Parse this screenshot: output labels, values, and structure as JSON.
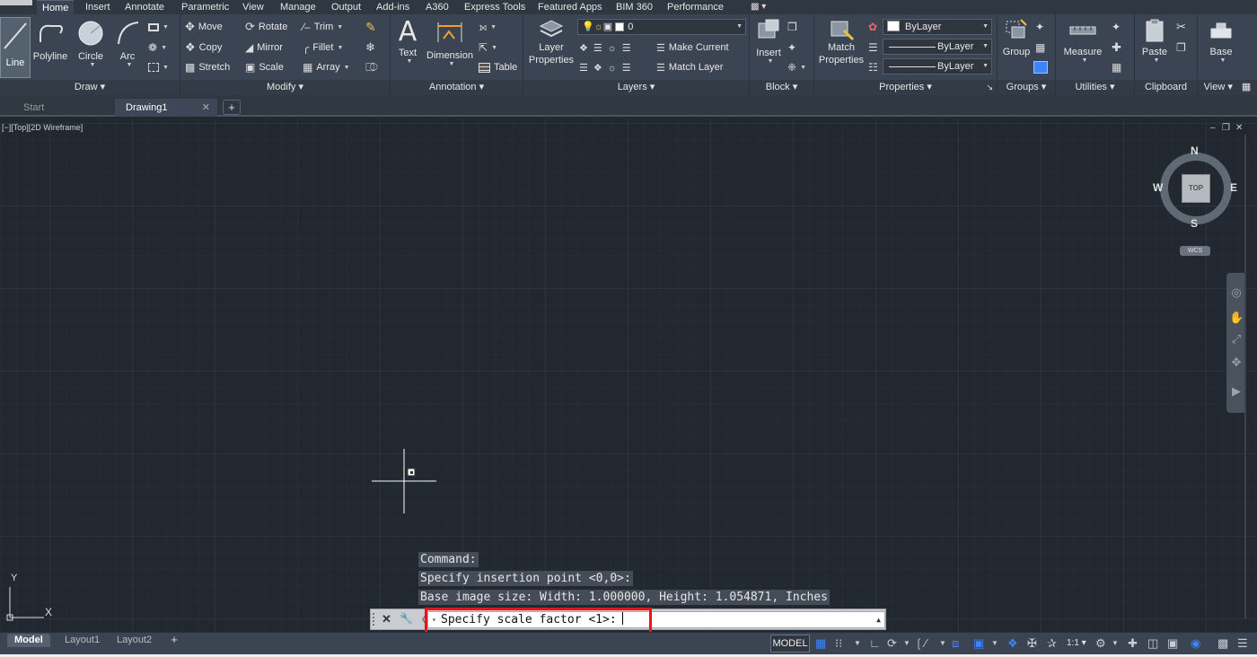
{
  "ribbon_tabs": [
    "Home",
    "Insert",
    "Annotate",
    "Parametric",
    "View",
    "Manage",
    "Output",
    "Add-ins",
    "A360",
    "Express Tools",
    "Featured Apps",
    "BIM 360",
    "Performance"
  ],
  "draw": {
    "title": "Draw",
    "line": "Line",
    "polyline": "Polyline",
    "circle": "Circle",
    "arc": "Arc"
  },
  "modify": {
    "title": "Modify",
    "move": "Move",
    "rotate": "Rotate",
    "trim": "Trim",
    "copy": "Copy",
    "mirror": "Mirror",
    "fillet": "Fillet",
    "stretch": "Stretch",
    "scale": "Scale",
    "array": "Array"
  },
  "annotation": {
    "title": "Annotation",
    "text": "Text",
    "dimension": "Dimension",
    "table": "Table"
  },
  "layers": {
    "title": "Layers",
    "layer_properties": "Layer Properties",
    "current_layer": "0",
    "make_current": "Make Current",
    "match_layer": "Match Layer"
  },
  "block": {
    "title": "Block",
    "insert": "Insert"
  },
  "properties": {
    "title": "Properties",
    "match_properties": "Match Properties",
    "color": "ByLayer",
    "linetype": "ByLayer",
    "lineweight": "ByLayer"
  },
  "groups": {
    "title": "Groups",
    "group": "Group"
  },
  "utilities": {
    "title": "Utilities",
    "measure": "Measure"
  },
  "clipboard": {
    "title": "Clipboard",
    "paste": "Paste"
  },
  "view": {
    "title": "View",
    "base": "Base"
  },
  "doc_tabs": {
    "start": "Start",
    "drawing": "Drawing1"
  },
  "viewport": {
    "label": "[−][Top][2D Wireframe]"
  },
  "viewcube": {
    "north": "N",
    "south": "S",
    "east": "E",
    "west": "W",
    "face": "TOP",
    "wcs": "WCS"
  },
  "ucs": {
    "x": "X",
    "y": "Y"
  },
  "command": {
    "history": [
      "Command:",
      "Specify insertion point <0,0>:",
      "Base image size: Width: 1.000000, Height: 1.054871, Inches"
    ],
    "prompt": "Specify scale factor <1>:"
  },
  "layout_tabs": [
    "Model",
    "Layout1",
    "Layout2"
  ],
  "status": {
    "model": "MODEL",
    "scale": "1:1"
  }
}
